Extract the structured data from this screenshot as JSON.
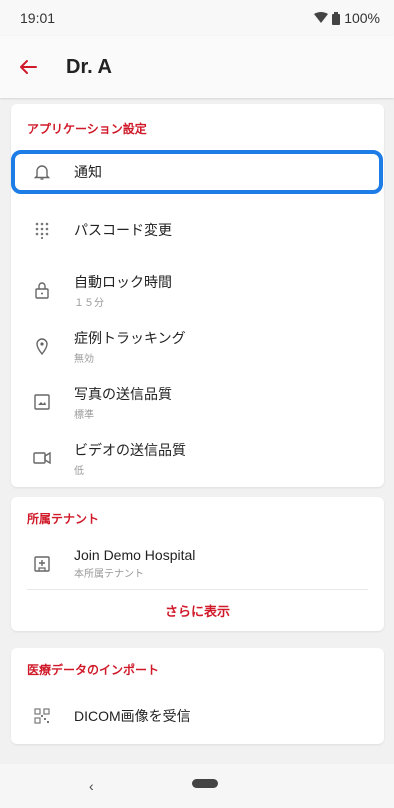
{
  "status": {
    "time": "19:01",
    "battery": "100%"
  },
  "header": {
    "title": "Dr. A"
  },
  "app_settings": {
    "title": "アプリケーション設定",
    "items": [
      {
        "label": "通知",
        "sub": "",
        "icon": "bell-icon"
      },
      {
        "label": "パスコード変更",
        "sub": "",
        "icon": "keypad-icon"
      },
      {
        "label": "自動ロック時間",
        "sub": "１５分",
        "icon": "lock-icon"
      },
      {
        "label": "症例トラッキング",
        "sub": "無効",
        "icon": "location-pin-icon"
      },
      {
        "label": "写真の送信品質",
        "sub": "標準",
        "icon": "image-icon"
      },
      {
        "label": "ビデオの送信品質",
        "sub": "低",
        "icon": "video-icon"
      }
    ]
  },
  "tenant": {
    "title": "所属テナント",
    "item": {
      "label": "Join Demo Hospital",
      "sub": "本所属テナント"
    },
    "show_more": "さらに表示"
  },
  "import": {
    "title": "医療データのインポート",
    "item": {
      "label": "DICOM画像を受信"
    }
  },
  "colors": {
    "accent": "#d01a2a",
    "highlight": "#1e7ce6"
  }
}
